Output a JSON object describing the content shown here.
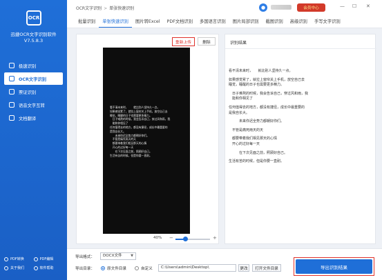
{
  "sidebar": {
    "logo_text": "OCR",
    "app_name": "迅捷OCR文字识别软件",
    "version": "V7.5.8.3",
    "items": [
      {
        "label": "极速识别",
        "active": false
      },
      {
        "label": "OCR文字识别",
        "active": true
      },
      {
        "label": "票证识别",
        "active": false
      },
      {
        "label": "语音文字互转",
        "active": false
      },
      {
        "label": "文档翻译",
        "active": false
      }
    ],
    "bottom_links": [
      "PDF转换",
      "PDF编辑",
      "关于我们",
      "软件帮助"
    ]
  },
  "topbar": {
    "breadcrumb_root": "OCR文字识别",
    "breadcrumb_sep": ">",
    "breadcrumb_current": "单张快速识别",
    "vip_label": "会员中心",
    "min_btn": "—",
    "max_btn": "☐",
    "close_btn": "✕"
  },
  "tabs": [
    "批量识别",
    "单张快速识别",
    "图片转Excel",
    "PDF文档识别",
    "多国语言识别",
    "图片局部识别",
    "截图识别",
    "高级识别",
    "手写文字识别"
  ],
  "active_tab": 1,
  "left_panel": {
    "reupload_label": "重新上传",
    "delete_label": "删除",
    "image_lines": [
      "看不清未来时，　　就比别人坚持久一点。",
      "如果感觉累了，就拉上窗帘关上手机，放空自己去",
      "睡觉，睡醒的日子也需要更多精力。",
      "　日子难熬的时候，我会告诉自己，穿过风和雨，我",
      "　能和你相见了",
      "任何值得去的地方，都没有捷径，成长中最重要的",
      "是我自长大。",
      "　　未来你迟全势力都朝好你们。",
      "　不管是痛死雨天的天",
      "　都要带着我们相见那天的心情",
      "　开心的过好每一天",
      "　　在下次见面之前，照顾好自己。",
      "生活有苦的时候，但是你要一直耐。"
    ],
    "zoom_label": "40%",
    "zoom_value": 0.28
  },
  "right_panel": {
    "title": "识别结果",
    "lines": [
      "看不清未来时，　　就比别人坚持久一点。",
      "",
      "如果感觉累了，就拉上窗帘关上手机，放空自己去",
      "睡觉，睡醒的日子也需要更多精力。",
      "",
      "　日子难熬的时候，我会告诉自己，穿过风和雨，我",
      "　能和你相见了",
      "",
      "任何值得去的地方，都没有捷径，成长中最重要的",
      "是我自长大。",
      "",
      "　　　未来你迟全势力都朝好你们。",
      "",
      "　不管是痛死雨天的天",
      "",
      "　都要带着我们相见那天的心情",
      "　开心的过好每一天",
      "",
      "　　　在下次见面之前，照顾好自己。",
      "",
      "生活有苦的时候，但是你要一直耐。"
    ]
  },
  "bottom": {
    "format_label": "导出格式：",
    "format_value": "DOCX文件",
    "dir_label": "导出目录：",
    "radio_original": "原文件目录",
    "radio_custom": "自定义",
    "path_value": "C:\\Users\\admin\\Desktop\\",
    "change_label": "更改",
    "open_folder_label": "打开文件目录",
    "export_label": "导出识别结果"
  },
  "colors": {
    "accent": "#1f6fd8",
    "highlight": "#e0302a",
    "vip": "#d23a2a"
  }
}
